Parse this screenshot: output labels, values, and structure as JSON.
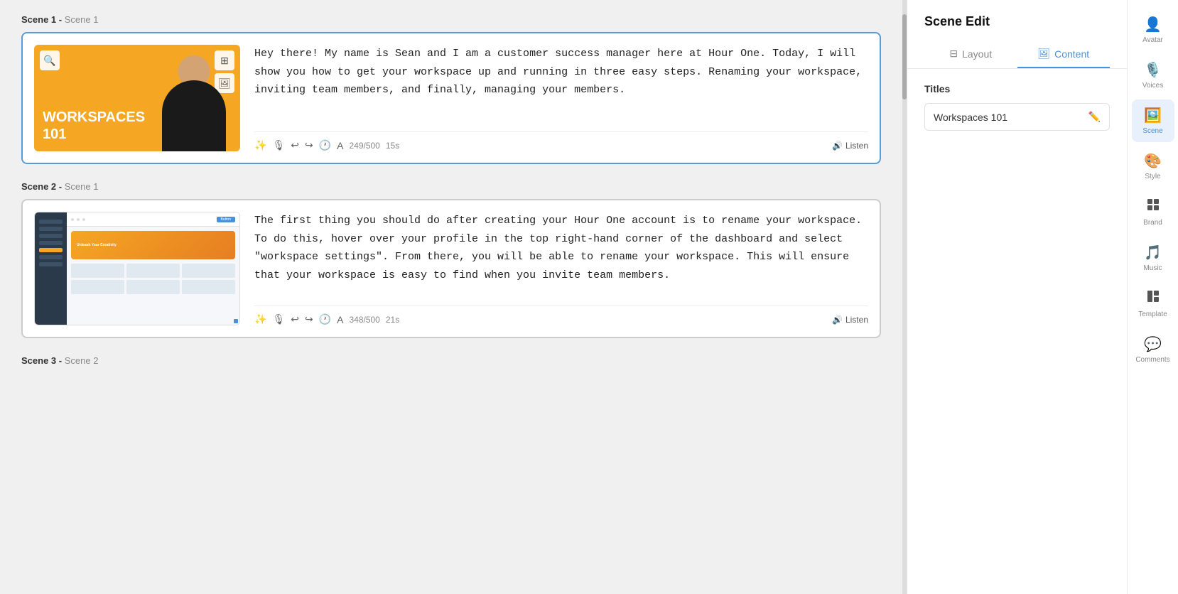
{
  "scenes": [
    {
      "id": 1,
      "label": "Scene 1 -",
      "sublabel": "Scene 1",
      "script": "Hey there! My name is Sean and I am a customer success manager here at Hour One. Today, I will show you how to get your workspace up and running in three easy steps. Renaming your workspace, inviting team members, and finally, managing your members.",
      "char_count": "249/500",
      "duration": "15s",
      "thumbnail_type": "orange",
      "thumbnail_title": "WORKSPACES\n101",
      "active": true
    },
    {
      "id": 2,
      "label": "Scene 2 -",
      "sublabel": "Scene 1",
      "script": "The first thing you should do after creating your Hour One account is to rename your workspace. To do this, hover over your profile in the top right-hand corner of the dashboard and select \"workspace settings\". From there, you will be able to rename your workspace. This will ensure that your workspace is easy to find when you invite team members.",
      "char_count": "348/500",
      "duration": "21s",
      "thumbnail_type": "screenshot",
      "active": false
    },
    {
      "id": 3,
      "label": "Scene 3 -",
      "sublabel": "Scene 2",
      "script": "",
      "active": false
    }
  ],
  "right_panel": {
    "title": "Scene Edit",
    "tabs": [
      {
        "id": "layout",
        "label": "Layout",
        "icon": "layout"
      },
      {
        "id": "content",
        "label": "Content",
        "icon": "content"
      }
    ],
    "active_tab": "content",
    "titles_section": "Titles",
    "title_value": "Workspaces 101"
  },
  "nav_items": [
    {
      "id": "avatar",
      "label": "Avatar",
      "icon": "👤"
    },
    {
      "id": "voices",
      "label": "Voices",
      "icon": "🎙️"
    },
    {
      "id": "scene",
      "label": "Scene",
      "icon": "🖼️",
      "active": true
    },
    {
      "id": "style",
      "label": "Style",
      "icon": "🎨"
    },
    {
      "id": "brand",
      "label": "Brand",
      "icon": "⬛"
    },
    {
      "id": "music",
      "label": "Music",
      "icon": "🎵"
    },
    {
      "id": "template",
      "label": "Template",
      "icon": "⊞"
    },
    {
      "id": "comments",
      "label": "Comments",
      "icon": "💬"
    }
  ]
}
